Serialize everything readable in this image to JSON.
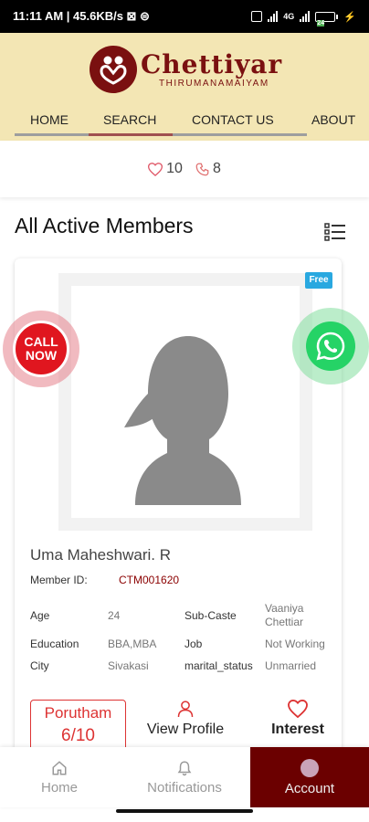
{
  "status_bar": {
    "time_info": "11:11 AM | 45.6KB/s ⊠ ⊜",
    "network": "4G",
    "battery": "24"
  },
  "brand": {
    "name": "Chettiyar",
    "subtitle": "THIRUMANAMAIYAM"
  },
  "nav": [
    {
      "label": "HOME"
    },
    {
      "label": "SEARCH",
      "active": true
    },
    {
      "label": "CONTACT US"
    },
    {
      "label": "ABOUT"
    }
  ],
  "counts": {
    "likes": "10",
    "calls": "8"
  },
  "section_title": "All Active Members",
  "badge": "Free",
  "fab": {
    "call_line1": "CALL",
    "call_line2": "NOW",
    "whatsapp_icon": "whatsapp-icon"
  },
  "member": {
    "name": "Uma Maheshwari. R",
    "id_label": "Member ID:",
    "id_value": "CTM001620",
    "age_label": "Age",
    "age": "24",
    "subcaste_label": "Sub-Caste",
    "subcaste_line1": "Vaaniya",
    "subcaste_line2": "Chettiar",
    "education_label": "Education",
    "education": "BBA,MBA",
    "job_label": "Job",
    "job": "Not Working",
    "city_label": "City",
    "city": "Sivakasi",
    "marital_label": "marital_status",
    "marital": "Unmarried"
  },
  "actions": {
    "porutham_label": "Porutham",
    "porutham_score": "6/10",
    "view_profile": "View Profile",
    "interest": "Interest"
  },
  "bottom_nav": [
    {
      "label": "Home",
      "icon": "home-icon"
    },
    {
      "label": "Notifications",
      "icon": "bell-icon"
    },
    {
      "label": "Account",
      "icon": "avatar-icon",
      "active": true
    }
  ],
  "colors": {
    "brand": "#7a1010",
    "header_bg": "#f3e6b4",
    "accent_red": "#d33333",
    "badge_blue": "#29a8e0"
  }
}
